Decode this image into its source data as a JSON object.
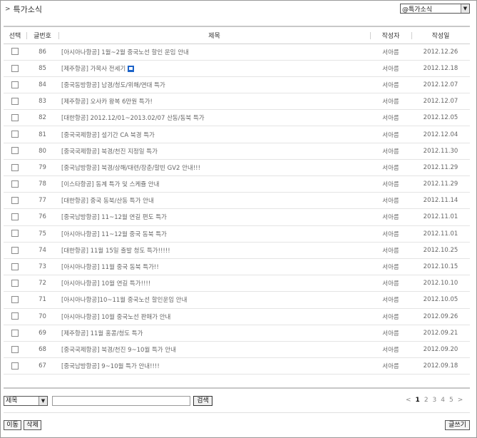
{
  "board": {
    "title": "특가소식",
    "board_select_value": "@특가소식"
  },
  "table": {
    "headers": [
      "선택",
      "글번호",
      "제목",
      "작성자",
      "작성일"
    ],
    "rows": [
      {
        "no": "86",
        "subject": "[아시아나항공] 1월~2월 중국노선 할인 운임 안내",
        "author": "서아름",
        "date": "2012.12.26",
        "new": false
      },
      {
        "no": "85",
        "subject": "[제주항공] 가목사 전세기",
        "author": "서아름",
        "date": "2012.12.18",
        "new": true
      },
      {
        "no": "84",
        "subject": "[중국동방항공] 남경/청도/위해/연대 특가",
        "author": "서아름",
        "date": "2012.12.07",
        "new": false
      },
      {
        "no": "83",
        "subject": "[제주항공] 오사카 왕복 6만원 특가!",
        "author": "서아름",
        "date": "2012.12.07",
        "new": false
      },
      {
        "no": "82",
        "subject": "[대한항공] 2012.12/01~2013.02/07 산동/동북 특가",
        "author": "서아름",
        "date": "2012.12.05",
        "new": false
      },
      {
        "no": "81",
        "subject": "[중국국제항공] 설기간 CA 북경 특가",
        "author": "서아름",
        "date": "2012.12.04",
        "new": false
      },
      {
        "no": "80",
        "subject": "[중국국제항공] 북경/천진 지정일 특가",
        "author": "서아름",
        "date": "2012.11.30",
        "new": false
      },
      {
        "no": "79",
        "subject": "[중국남방항공] 북경/상해/대련/장춘/할빈 GV2 안내!!!",
        "author": "서아름",
        "date": "2012.11.29",
        "new": false
      },
      {
        "no": "78",
        "subject": "[이스타항공] 동계 특가 및 스케쥴 안내",
        "author": "서아름",
        "date": "2012.11.29",
        "new": false
      },
      {
        "no": "77",
        "subject": "[대한항공] 중국 동북/산동 특가 안내",
        "author": "서아름",
        "date": "2012.11.14",
        "new": false
      },
      {
        "no": "76",
        "subject": "[중국남방항공] 11~12월 연길 편도 특가",
        "author": "서아름",
        "date": "2012.11.01",
        "new": false
      },
      {
        "no": "75",
        "subject": "[아시아나항공] 11~12월 중국 동북 특가",
        "author": "서아름",
        "date": "2012.11.01",
        "new": false
      },
      {
        "no": "74",
        "subject": "[대한항공] 11월 15일 출발 청도 특가!!!!!",
        "author": "서아름",
        "date": "2012.10.25",
        "new": false
      },
      {
        "no": "73",
        "subject": "[아시아나항공] 11월 중국 동북 특가!!",
        "author": "서아름",
        "date": "2012.10.15",
        "new": false
      },
      {
        "no": "72",
        "subject": "[아시아나항공] 10월 연길 특가!!!!",
        "author": "서아름",
        "date": "2012.10.10",
        "new": false
      },
      {
        "no": "71",
        "subject": "[아시아나항공]10~11월 중국노선 할인운임 안내",
        "author": "서아름",
        "date": "2012.10.05",
        "new": false
      },
      {
        "no": "70",
        "subject": "[아시아나항공] 10월 중국노선 판매가 안내",
        "author": "서아름",
        "date": "2012.09.26",
        "new": false
      },
      {
        "no": "69",
        "subject": "[제주항공] 11월 홍콩/청도 특가",
        "author": "서아름",
        "date": "2012.09.21",
        "new": false
      },
      {
        "no": "68",
        "subject": "[중국국제항공] 북경/천진 9~10월 특가 안내",
        "author": "서아름",
        "date": "2012.09.20",
        "new": false
      },
      {
        "no": "67",
        "subject": "[중국남방항공] 9~10월 특가 안내!!!!",
        "author": "서아름",
        "date": "2012.09.18",
        "new": false
      }
    ]
  },
  "search": {
    "field_value": "제목",
    "query": "",
    "button_label": "검색"
  },
  "pagination": {
    "prev": "<",
    "pages": [
      "1",
      "2",
      "3",
      "4",
      "5"
    ],
    "current": "1",
    "next": ">"
  },
  "actions": {
    "move_label": "이동",
    "delete_label": "삭제",
    "write_label": "글쓰기"
  },
  "colors": {
    "border": "#9a9a9a",
    "new_icon": "#1c63c8"
  },
  "icons": {
    "title_arrow": "chevron-right-icon",
    "new_post": "new-post-icon",
    "dropdown": "dropdown-arrow-icon"
  }
}
